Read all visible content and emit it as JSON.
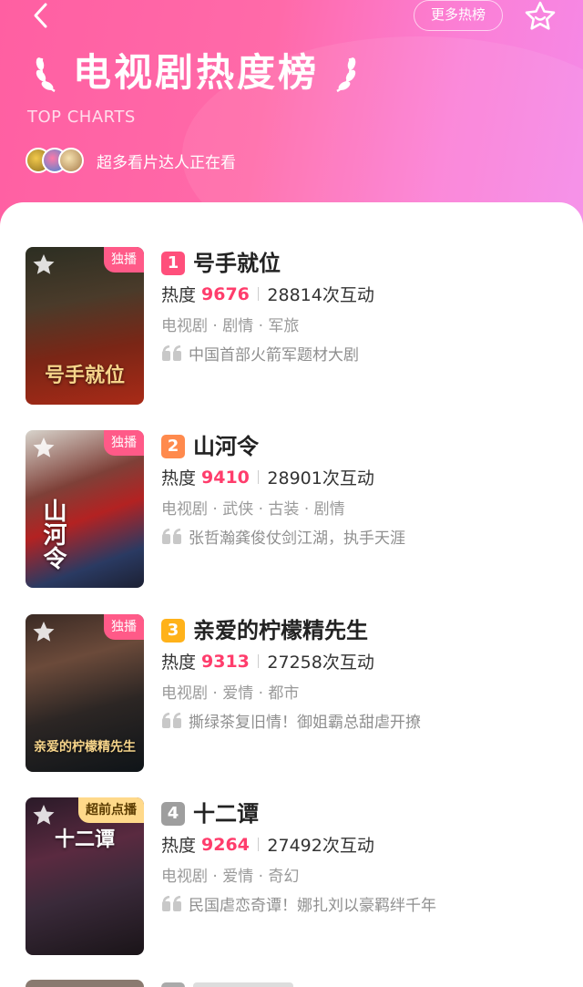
{
  "header": {
    "title": "电视剧热度榜",
    "subtitle": "TOP CHARTS",
    "more_label": "更多热榜",
    "watchers_text": "超多看片达人正在看",
    "back_icon": "chevron-left-icon",
    "fav_icon": "star-outline-icon"
  },
  "colors": {
    "accent": "#ff3d6c",
    "header_start": "#ff5fa2",
    "header_end": "#f58ae8",
    "rank1": "#ff4f7b",
    "rank2": "#ff8a4d",
    "rank3": "#ffb21a",
    "rank4": "#9e9e9e"
  },
  "labels": {
    "heat": "热度"
  },
  "shows": [
    {
      "rank": "1",
      "title": "号手就位",
      "heat": "9676",
      "interactions": "28814次互动",
      "tags": "电视剧 · 剧情 · 军旅",
      "quote": "中国首部火箭军题材大剧",
      "badge": "独播",
      "poster_text": "号手就位"
    },
    {
      "rank": "2",
      "title": "山河令",
      "heat": "9410",
      "interactions": "28901次互动",
      "tags": "电视剧 · 武侠 · 古装 · 剧情",
      "quote": "张哲瀚龚俊仗剑江湖，执手天涯",
      "badge": "独播",
      "poster_text": "山河令"
    },
    {
      "rank": "3",
      "title": "亲爱的柠檬精先生",
      "heat": "9313",
      "interactions": "27258次互动",
      "tags": "电视剧 · 爱情 · 都市",
      "quote": "撕绿茶复旧情！御姐霸总甜虐开撩",
      "badge": "独播",
      "poster_text": "亲爱的柠檬精先生"
    },
    {
      "rank": "4",
      "title": "十二谭",
      "heat": "9264",
      "interactions": "27492次互动",
      "tags": "电视剧 · 爱情 · 奇幻",
      "quote": "民国虐恋奇谭！娜扎刘以豪羁绊千年",
      "badge": "超前点播",
      "poster_text": "十二谭"
    }
  ]
}
